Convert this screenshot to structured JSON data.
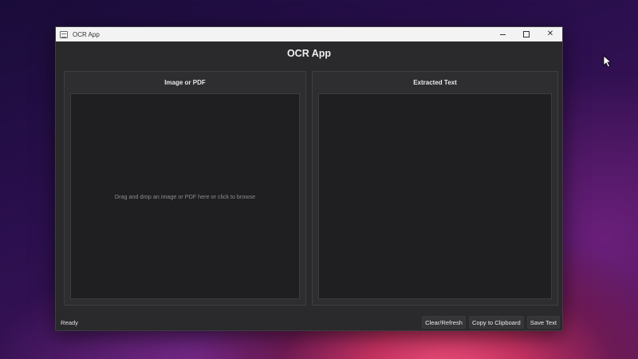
{
  "window": {
    "title": "OCR App",
    "controls": {
      "minimize": "minimize-icon",
      "maximize": "maximize-icon",
      "close": "close-icon"
    }
  },
  "header": {
    "title": "OCR App"
  },
  "left_panel": {
    "title": "Image or PDF",
    "hint": "Drag and drop an image or PDF here or click to browse"
  },
  "right_panel": {
    "title": "Extracted Text",
    "text": ""
  },
  "statusbar": {
    "status": "Ready",
    "buttons": {
      "clear": "Clear/Refresh",
      "copy": "Copy to Clipboard",
      "save": "Save Text"
    }
  },
  "colors": {
    "window_bg": "#2a2a2c",
    "titlebar_bg": "#f3f3f3",
    "drop_area_bg": "#1f1f21"
  }
}
